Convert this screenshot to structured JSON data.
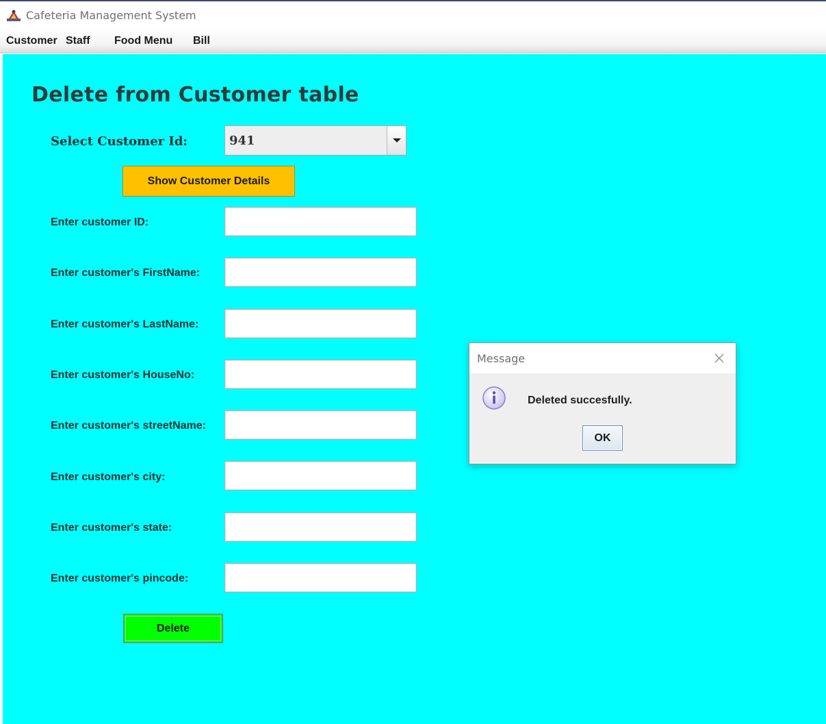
{
  "window": {
    "title": "Cafeteria Management System",
    "icon": "java-app-icon"
  },
  "menu": {
    "items": [
      "Customer",
      "Staff",
      "Food Menu",
      "Bill"
    ]
  },
  "form": {
    "heading": "Delete from Customer table",
    "select_label": "Select Customer Id:",
    "selected_id": "941",
    "show_button": "Show Customer Details",
    "fields": [
      {
        "label": "Enter customer ID:",
        "value": ""
      },
      {
        "label": "Enter customer's FirstName:",
        "value": ""
      },
      {
        "label": "Enter customer's LastName:",
        "value": ""
      },
      {
        "label": "Enter customer's HouseNo:",
        "value": ""
      },
      {
        "label": "Enter customer's streetName:",
        "value": ""
      },
      {
        "label": "Enter customer's city:",
        "value": ""
      },
      {
        "label": "Enter customer's state:",
        "value": ""
      },
      {
        "label": "Enter customer's pincode:",
        "value": ""
      }
    ],
    "delete_button": "Delete"
  },
  "dialog": {
    "title": "Message",
    "message": "Deleted succesfully.",
    "ok_button": "OK",
    "icon": "info-icon"
  },
  "colors": {
    "background": "#00ffff",
    "show_button": "#ffc000",
    "delete_button": "#00ff00"
  }
}
